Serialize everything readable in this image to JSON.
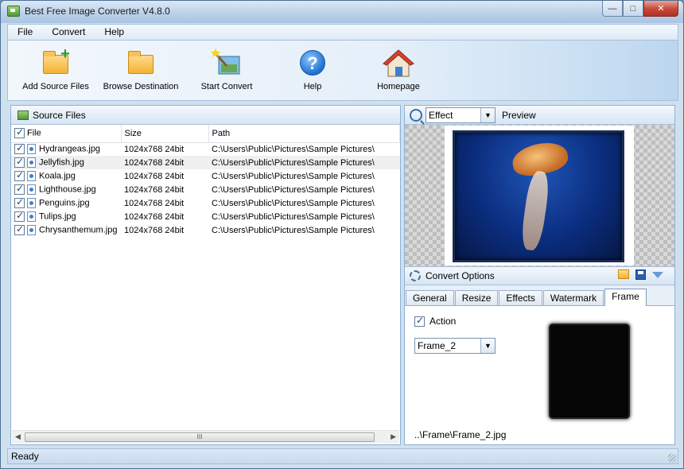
{
  "window": {
    "title": "Best Free Image Converter V4.8.0",
    "controls": {
      "minimize": "—",
      "maximize": "□",
      "close": "✕"
    }
  },
  "menu": [
    {
      "label": "File"
    },
    {
      "label": "Convert"
    },
    {
      "label": "Help"
    }
  ],
  "toolbar": [
    {
      "label": "Add Source Files",
      "icon": "add-folder-icon"
    },
    {
      "label": "Browse Destination",
      "icon": "folder-icon"
    },
    {
      "label": "Start Convert",
      "icon": "magic-wand-icon"
    },
    {
      "label": "Help",
      "icon": "help-icon",
      "glyph": "?"
    },
    {
      "label": "Homepage",
      "icon": "home-icon"
    }
  ],
  "source_panel": {
    "title": "Source Files",
    "columns": [
      "File",
      "Size",
      "Path"
    ],
    "rows": [
      {
        "file": "Hydrangeas.jpg",
        "size": "1024x768  24bit",
        "path": "C:\\Users\\Public\\Pictures\\Sample Pictures\\"
      },
      {
        "file": "Jellyfish.jpg",
        "size": "1024x768  24bit",
        "path": "C:\\Users\\Public\\Pictures\\Sample Pictures\\"
      },
      {
        "file": "Koala.jpg",
        "size": "1024x768  24bit",
        "path": "C:\\Users\\Public\\Pictures\\Sample Pictures\\"
      },
      {
        "file": "Lighthouse.jpg",
        "size": "1024x768  24bit",
        "path": "C:\\Users\\Public\\Pictures\\Sample Pictures\\"
      },
      {
        "file": "Penguins.jpg",
        "size": "1024x768  24bit",
        "path": "C:\\Users\\Public\\Pictures\\Sample Pictures\\"
      },
      {
        "file": "Tulips.jpg",
        "size": "1024x768  24bit",
        "path": "C:\\Users\\Public\\Pictures\\Sample Pictures\\"
      },
      {
        "file": "Chrysanthemum.jpg",
        "size": "1024x768  24bit",
        "path": "C:\\Users\\Public\\Pictures\\Sample Pictures\\"
      }
    ],
    "scroll_grip": "III"
  },
  "preview_panel": {
    "effect_select": "Effect",
    "label": "Preview"
  },
  "convert_options": {
    "title": "Convert Options",
    "tabs": [
      "General",
      "Resize",
      "Effects",
      "Watermark",
      "Frame"
    ],
    "active_tab": "Frame",
    "frame": {
      "action_label": "Action",
      "action_checked": true,
      "frame_select": "Frame_2",
      "frame_path": "..\\Frame\\Frame_2.jpg"
    }
  },
  "status": {
    "text": "Ready"
  },
  "colors": {
    "accent": "#aac5e4",
    "close_button": "#c4483a"
  }
}
